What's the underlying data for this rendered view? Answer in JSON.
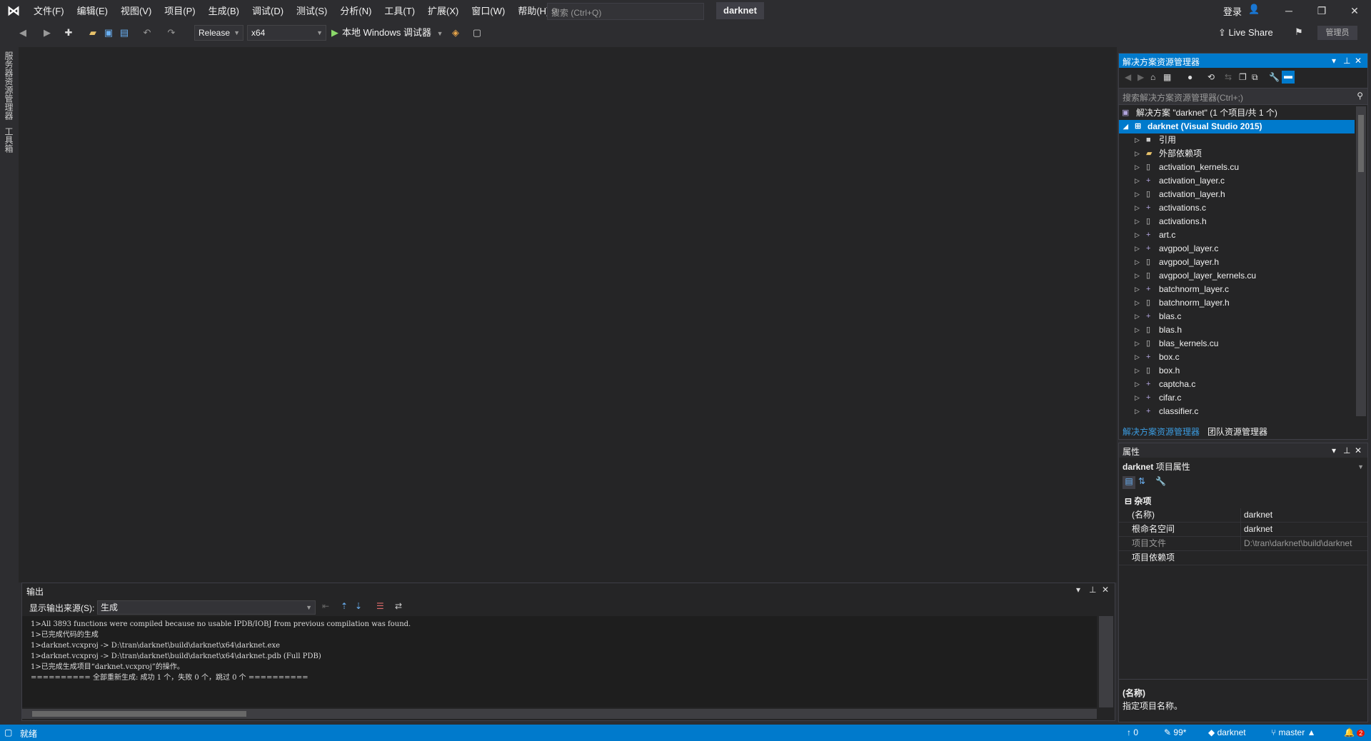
{
  "title_bar": {
    "menus": [
      "文件(F)",
      "编辑(E)",
      "视图(V)",
      "项目(P)",
      "生成(B)",
      "调试(D)",
      "测试(S)",
      "分析(N)",
      "工具(T)",
      "扩展(X)",
      "窗口(W)",
      "帮助(H)"
    ],
    "search_placeholder": "搜索 (Ctrl+Q)",
    "window_title": "darknet",
    "login_label": "登录",
    "window_buttons": {
      "minimize": "─",
      "restore": "❐",
      "close": "✕"
    }
  },
  "toolbar": {
    "configuration": "Release",
    "platform": "x64",
    "debugger_label": "本地 Windows 调试器",
    "live_share_label": "Live Share",
    "admin_badge": "管理员"
  },
  "left_rail": {
    "tabs": [
      "服务器资源管理器",
      "工具箱"
    ]
  },
  "solution_explorer": {
    "title": "解决方案资源管理器",
    "search_placeholder": "搜索解决方案资源管理器(Ctrl+;)",
    "solution_label": "解决方案 \"darknet\" (1 个项目/共 1 个)",
    "project_label": "darknet (Visual Studio 2015)",
    "items": [
      {
        "label": "引用",
        "icon": "references-icon"
      },
      {
        "label": "外部依赖项",
        "icon": "external-deps-icon"
      },
      {
        "label": "activation_kernels.cu",
        "icon": "file-icon"
      },
      {
        "label": "activation_layer.c",
        "icon": "cpp-file-icon"
      },
      {
        "label": "activation_layer.h",
        "icon": "header-file-icon"
      },
      {
        "label": "activations.c",
        "icon": "cpp-file-icon"
      },
      {
        "label": "activations.h",
        "icon": "header-file-icon"
      },
      {
        "label": "art.c",
        "icon": "cpp-file-icon"
      },
      {
        "label": "avgpool_layer.c",
        "icon": "cpp-file-icon"
      },
      {
        "label": "avgpool_layer.h",
        "icon": "header-file-icon"
      },
      {
        "label": "avgpool_layer_kernels.cu",
        "icon": "file-icon"
      },
      {
        "label": "batchnorm_layer.c",
        "icon": "cpp-file-icon"
      },
      {
        "label": "batchnorm_layer.h",
        "icon": "header-file-icon"
      },
      {
        "label": "blas.c",
        "icon": "cpp-file-icon"
      },
      {
        "label": "blas.h",
        "icon": "header-file-icon"
      },
      {
        "label": "blas_kernels.cu",
        "icon": "file-icon"
      },
      {
        "label": "box.c",
        "icon": "cpp-file-icon"
      },
      {
        "label": "box.h",
        "icon": "header-file-icon"
      },
      {
        "label": "captcha.c",
        "icon": "cpp-file-icon"
      },
      {
        "label": "cifar.c",
        "icon": "cpp-file-icon"
      },
      {
        "label": "classifier.c",
        "icon": "cpp-file-icon"
      }
    ],
    "tabs": [
      "解决方案资源管理器",
      "团队资源管理器"
    ]
  },
  "properties": {
    "title": "属性",
    "object_name": "darknet",
    "object_type": "项目属性",
    "category": "杂项",
    "rows": [
      {
        "name": "(名称)",
        "value": "darknet",
        "dim": false
      },
      {
        "name": "根命名空间",
        "value": "darknet",
        "dim": false
      },
      {
        "name": "项目文件",
        "value": "D:\\tran\\darknet\\build\\darknet",
        "dim": true
      },
      {
        "name": "项目依赖项",
        "value": "",
        "dim": false
      }
    ],
    "desc_title": "(名称)",
    "desc_text": "指定项目名称。"
  },
  "output": {
    "title": "输出",
    "source_label": "显示输出来源(S):",
    "source_value": "生成",
    "lines": [
      "1>All 3893 functions were compiled because no usable IPDB/IOBJ from previous compilation was found.",
      "1>已完成代码的生成",
      "1>darknet.vcxproj -> D:\\tran\\darknet\\build\\darknet\\x64\\darknet.exe",
      "1>darknet.vcxproj -> D:\\tran\\darknet\\build\\darknet\\x64\\darknet.pdb (Full PDB)",
      "1>已完成生成项目“darknet.vcxproj”的操作。",
      "========== 全部重新生成: 成功 1 个，失败 0 个，跳过 0 个 =========="
    ]
  },
  "status_bar": {
    "ready": "就绪",
    "push_count": "0",
    "pending_changes": "99*",
    "repo": "darknet",
    "branch": "master",
    "notifications": "2"
  },
  "colors": {
    "accent": "#007acc",
    "background": "#2d2d30",
    "panel": "#252526"
  }
}
